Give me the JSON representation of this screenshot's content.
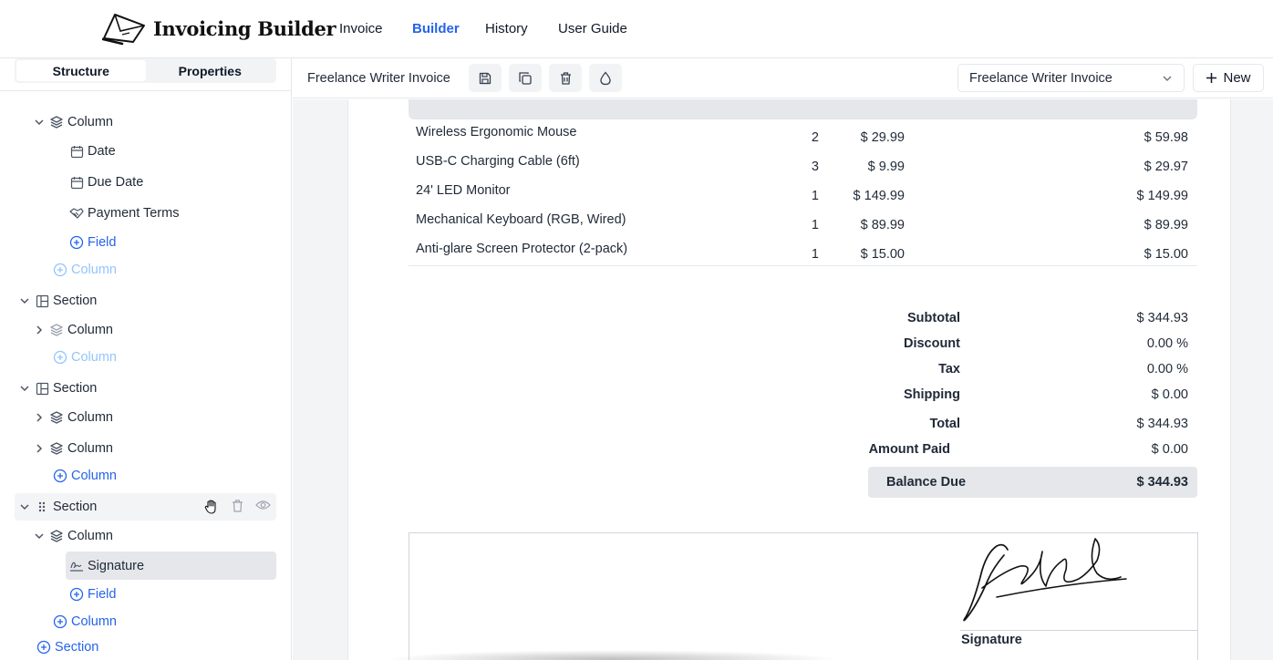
{
  "app": {
    "title": "Invoicing Builder"
  },
  "nav": {
    "items": [
      "Invoice",
      "Builder",
      "History",
      "User Guide"
    ],
    "active": "Builder"
  },
  "left_panel": {
    "tabs": [
      "Structure",
      "Properties"
    ],
    "active_tab": "Structure",
    "tree": [
      {
        "label": "Column",
        "type": "column"
      },
      {
        "label": "Date",
        "type": "field"
      },
      {
        "label": "Due Date",
        "type": "field"
      },
      {
        "label": "Payment Terms",
        "type": "field"
      },
      {
        "label": "Field",
        "type": "add"
      },
      {
        "label": "Column",
        "type": "add"
      },
      {
        "label": "Section",
        "type": "section"
      },
      {
        "label": "Column",
        "type": "column"
      },
      {
        "label": "Column",
        "type": "add"
      },
      {
        "label": "Section",
        "type": "section"
      },
      {
        "label": "Column",
        "type": "column"
      },
      {
        "label": "Column",
        "type": "column"
      },
      {
        "label": "Column",
        "type": "add"
      },
      {
        "label": "Section",
        "type": "section"
      },
      {
        "label": "Column",
        "type": "column"
      },
      {
        "label": "Signature",
        "type": "field"
      },
      {
        "label": "Field",
        "type": "add"
      },
      {
        "label": "Column",
        "type": "add"
      },
      {
        "label": "Section",
        "type": "add"
      }
    ]
  },
  "toolbar": {
    "template_name": "Freelance Writer Invoice",
    "select_value": "Freelance Writer Invoice",
    "new_label": "New",
    "icons": [
      "save-icon",
      "copy-icon",
      "trash-icon",
      "droplet-icon"
    ]
  },
  "invoice": {
    "items": [
      {
        "desc": "Wireless Ergonomic Mouse",
        "qty": "2",
        "rate": "$ 29.99",
        "amount": "$ 59.98"
      },
      {
        "desc": "USB-C Charging Cable (6ft)",
        "qty": "3",
        "rate": "$ 9.99",
        "amount": "$ 29.97"
      },
      {
        "desc": "24' LED Monitor",
        "qty": "1",
        "rate": "$ 149.99",
        "amount": "$ 149.99"
      },
      {
        "desc": "Mechanical Keyboard (RGB, Wired)",
        "qty": "1",
        "rate": "$ 89.99",
        "amount": "$ 89.99"
      },
      {
        "desc": "Anti-glare Screen Protector (2-pack)",
        "qty": "1",
        "rate": "$ 15.00",
        "amount": "$ 15.00"
      }
    ],
    "totals": {
      "subtotal_label": "Subtotal",
      "subtotal": "$ 344.93",
      "discount_label": "Discount",
      "discount": "0.00 %",
      "tax_label": "Tax",
      "tax": "0.00 %",
      "shipping_label": "Shipping",
      "shipping": "$ 0.00",
      "total_label": "Total",
      "total": "$ 344.93",
      "paid_label": "Amount Paid",
      "paid": "$ 0.00",
      "balance_label": "Balance Due",
      "balance": "$ 344.93"
    },
    "signature_label": "Signature"
  },
  "colors": {
    "accent": "#2563eb",
    "selected_bg": "#e5e7eb",
    "canvas_bg": "#f3f4f6"
  }
}
